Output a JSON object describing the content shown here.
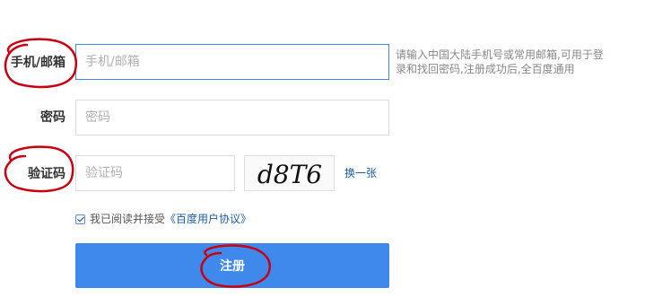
{
  "form": {
    "phone_label": "手机/邮箱",
    "phone_placeholder": "手机/邮箱",
    "phone_hint": "请输入中国大陆手机号或常用邮箱,可用于登录和找回密码,注册成功后,全百度通用",
    "password_label": "密码",
    "password_placeholder": "密码",
    "captcha_label": "验证码",
    "captcha_placeholder": "验证码",
    "captcha_text": "d8T6",
    "change_captcha": "换一张",
    "agree_prefix": "我已阅读并接受",
    "agree_link": "《百度用户协议》",
    "agree_checked": true,
    "submit_label": "注册"
  },
  "colors": {
    "primary": "#3f89ec",
    "link": "#1a5c9f",
    "annotation": "#c8000f"
  }
}
